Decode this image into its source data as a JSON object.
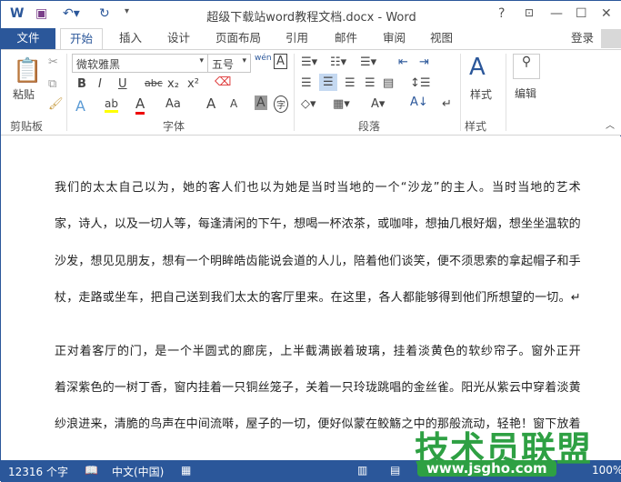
{
  "app": {
    "title": "超级下载站word教程文档.docx - Word"
  },
  "quick_access": {
    "word_icon": "word-logo-icon",
    "save": "save-icon",
    "undo": "undo-icon",
    "redo": "redo-icon",
    "customize": "dropdown-icon"
  },
  "window": {
    "help": "?",
    "ribbon_options": "ribbon-display-icon",
    "minimize": "minimize-icon",
    "maximize": "maximize-icon",
    "close": "close-icon"
  },
  "tabs": [
    "文件",
    "开始",
    "插入",
    "设计",
    "页面布局",
    "引用",
    "邮件",
    "审阅",
    "视图"
  ],
  "login": "登录",
  "ribbon": {
    "clipboard": {
      "paste": "粘贴",
      "label": "剪贴板"
    },
    "font": {
      "name": "微软雅黑",
      "size": "五号",
      "label": "字体",
      "bold": "B",
      "italic": "I",
      "underline": "U",
      "strike": "abc",
      "sub": "x₂",
      "sup": "x²",
      "case": "Aa",
      "grow": "A",
      "shrink": "A",
      "shade": "A",
      "circle": "字",
      "phonetic": "wén",
      "border": "A"
    },
    "paragraph": {
      "label": "段落"
    },
    "styles": {
      "button": "样式",
      "label": "样式"
    },
    "editing": {
      "button": "编辑"
    }
  },
  "document": {
    "lines": [
      "我们的太太自己以为，她的客人们也以为她是当时当地的一个“沙龙”的主人。当时当地的艺术",
      "家，诗人，以及一切人等，每逢清闲的下午，想喝一杯浓茶，或咖啡，想抽几根好烟，想坐坐温软的",
      "沙发，想见见朋友，想有一个明眸皓齿能说会道的人儿，陪着他们谈笑，便不须思索的拿起帽子和手",
      "杖，走路或坐车，把自己送到我们太太的客厅里来。在这里，各人都能够得到他们所想望的一切。↵",
      "正对着客厅的门，是一个半圆式的廊庑，上半截满嵌着玻璃，挂着淡黄色的软纱帘子。窗外正开",
      "着深紫色的一树丁香，窗内挂着一只铜丝笼子，关着一只玲珑跳唱的金丝雀。阳光从紫云中穿着淡黄",
      "纱浪进来，清脆的鸟声在中间流啭，屋子的一切，便好似蒙在鲛觞之中的那般流动，轻艳！窗下放着"
    ]
  },
  "status": {
    "word_count": "12316 个字",
    "language": "中文(中国)",
    "zoom": "100%"
  },
  "watermark": {
    "brand": "技术员联盟",
    "url": "www.jsgho.com"
  },
  "colors": {
    "accent": "#2b579a"
  }
}
